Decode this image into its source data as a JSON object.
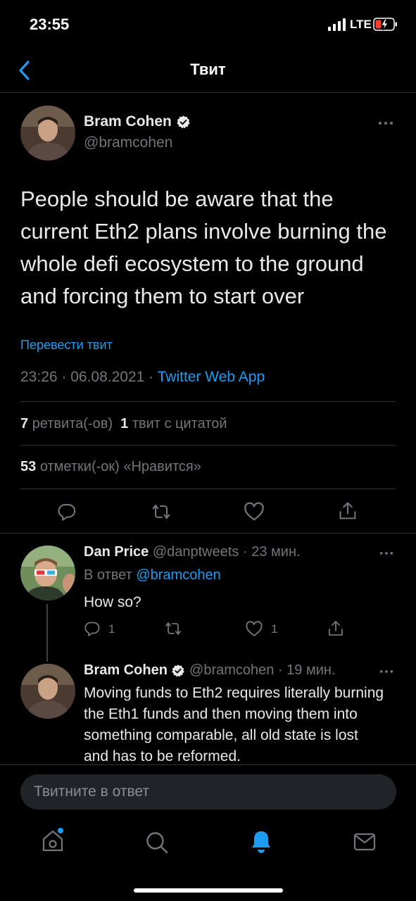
{
  "status_bar": {
    "time": "23:55",
    "network": "LTE"
  },
  "header": {
    "title": "Твит"
  },
  "main_tweet": {
    "author_name": "Bram Cohen",
    "author_handle": "@bramcohen",
    "text": "People should be aware that the current Eth2 plans involve burning the whole defi ecosystem to the ground and forcing them to start over",
    "translate_label": "Перевести твит",
    "timestamp": "23:26 · 06.08.2021 · ",
    "source": "Twitter Web App",
    "retweets_count": "7",
    "retweets_label": "ретвита(-ов)",
    "quotes_count": "1",
    "quotes_label": "твит с цитатой",
    "likes_count": "53",
    "likes_label": "отметки(-ок) «Нравится»"
  },
  "replies": [
    {
      "author_name": "Dan Price",
      "author_handle": "@danptweets",
      "time": "· 23 мин.",
      "reply_to_prefix": "В ответ ",
      "reply_to_handle": "@bramcohen",
      "text": "How so?",
      "reply_count": "1",
      "like_count": "1"
    },
    {
      "author_name": "Bram Cohen",
      "author_handle": "@bramcohen",
      "time": "· 19 мин.",
      "text": "Moving funds to Eth2 requires literally burning the Eth1 funds and then moving them into something comparable, all old state is lost and has to be reformed."
    }
  ],
  "compose": {
    "placeholder": "Твитните в ответ"
  },
  "colors": {
    "accent": "#1d9bf0",
    "background": "#000000",
    "muted": "#71767b",
    "battery_low": "#ff3b30"
  },
  "tab_bar": {
    "icons": [
      "home-icon",
      "search-icon",
      "notifications-icon",
      "messages-icon"
    ]
  }
}
